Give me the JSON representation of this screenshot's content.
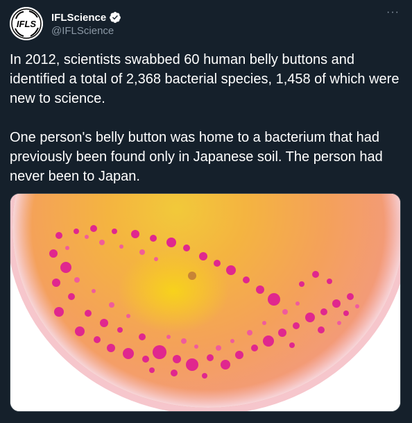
{
  "author": {
    "display_name": "IFLScience",
    "handle": "@IFLScience",
    "verified": true,
    "avatar_icon": "iflscience-logo-icon",
    "avatar_text": "IFLS"
  },
  "menu": {
    "more_label": "···"
  },
  "tweet": {
    "paragraph_1": "In 2012, scientists swabbed 60 human belly buttons and identified a total of 2,368 bacterial species, 1,458 of which were new to science.",
    "paragraph_2": "One person's belly button was home to a bacterium that had previously been found only in Japanese soil. The person had never been to Japan."
  },
  "media": {
    "icon": "petri-dish-bacteria-photo"
  },
  "colors": {
    "background": "#15202b",
    "text": "#ffffff",
    "secondary_text": "#8b98a5",
    "verified_blue": "#ffffff"
  }
}
